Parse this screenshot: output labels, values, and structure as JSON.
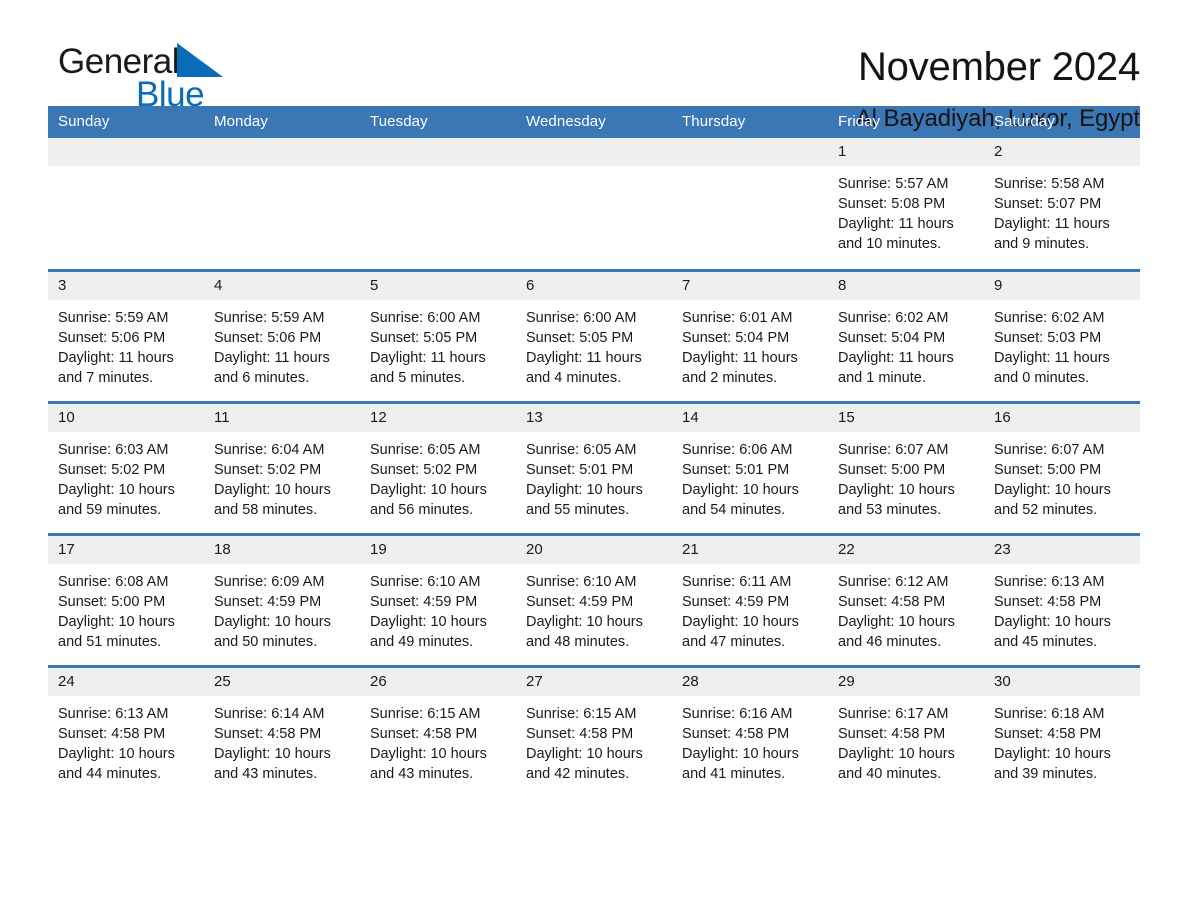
{
  "brand": {
    "name_part1": "General",
    "name_part2": "Blue",
    "logo_icon": "blue-triangle-mark",
    "accent_color": "#0a6cb8"
  },
  "header": {
    "title": "November 2024",
    "subtitle": "Al Bayadiyah, Luxor, Egypt"
  },
  "theme": {
    "header_bg": "#3b77b4",
    "daynum_bg": "#efefef",
    "row_border": "#3b77b4"
  },
  "weekday_headers": [
    "Sunday",
    "Monday",
    "Tuesday",
    "Wednesday",
    "Thursday",
    "Friday",
    "Saturday"
  ],
  "weeks": [
    [
      {
        "day": "",
        "empty": true,
        "sunrise": "",
        "sunset": "",
        "daylight1": "",
        "daylight2": ""
      },
      {
        "day": "",
        "empty": true,
        "sunrise": "",
        "sunset": "",
        "daylight1": "",
        "daylight2": ""
      },
      {
        "day": "",
        "empty": true,
        "sunrise": "",
        "sunset": "",
        "daylight1": "",
        "daylight2": ""
      },
      {
        "day": "",
        "empty": true,
        "sunrise": "",
        "sunset": "",
        "daylight1": "",
        "daylight2": ""
      },
      {
        "day": "",
        "empty": true,
        "sunrise": "",
        "sunset": "",
        "daylight1": "",
        "daylight2": ""
      },
      {
        "day": "1",
        "empty": false,
        "sunrise": "Sunrise: 5:57 AM",
        "sunset": "Sunset: 5:08 PM",
        "daylight1": "Daylight: 11 hours",
        "daylight2": "and 10 minutes."
      },
      {
        "day": "2",
        "empty": false,
        "sunrise": "Sunrise: 5:58 AM",
        "sunset": "Sunset: 5:07 PM",
        "daylight1": "Daylight: 11 hours",
        "daylight2": "and 9 minutes."
      }
    ],
    [
      {
        "day": "3",
        "empty": false,
        "sunrise": "Sunrise: 5:59 AM",
        "sunset": "Sunset: 5:06 PM",
        "daylight1": "Daylight: 11 hours",
        "daylight2": "and 7 minutes."
      },
      {
        "day": "4",
        "empty": false,
        "sunrise": "Sunrise: 5:59 AM",
        "sunset": "Sunset: 5:06 PM",
        "daylight1": "Daylight: 11 hours",
        "daylight2": "and 6 minutes."
      },
      {
        "day": "5",
        "empty": false,
        "sunrise": "Sunrise: 6:00 AM",
        "sunset": "Sunset: 5:05 PM",
        "daylight1": "Daylight: 11 hours",
        "daylight2": "and 5 minutes."
      },
      {
        "day": "6",
        "empty": false,
        "sunrise": "Sunrise: 6:00 AM",
        "sunset": "Sunset: 5:05 PM",
        "daylight1": "Daylight: 11 hours",
        "daylight2": "and 4 minutes."
      },
      {
        "day": "7",
        "empty": false,
        "sunrise": "Sunrise: 6:01 AM",
        "sunset": "Sunset: 5:04 PM",
        "daylight1": "Daylight: 11 hours",
        "daylight2": "and 2 minutes."
      },
      {
        "day": "8",
        "empty": false,
        "sunrise": "Sunrise: 6:02 AM",
        "sunset": "Sunset: 5:04 PM",
        "daylight1": "Daylight: 11 hours",
        "daylight2": "and 1 minute."
      },
      {
        "day": "9",
        "empty": false,
        "sunrise": "Sunrise: 6:02 AM",
        "sunset": "Sunset: 5:03 PM",
        "daylight1": "Daylight: 11 hours",
        "daylight2": "and 0 minutes."
      }
    ],
    [
      {
        "day": "10",
        "empty": false,
        "sunrise": "Sunrise: 6:03 AM",
        "sunset": "Sunset: 5:02 PM",
        "daylight1": "Daylight: 10 hours",
        "daylight2": "and 59 minutes."
      },
      {
        "day": "11",
        "empty": false,
        "sunrise": "Sunrise: 6:04 AM",
        "sunset": "Sunset: 5:02 PM",
        "daylight1": "Daylight: 10 hours",
        "daylight2": "and 58 minutes."
      },
      {
        "day": "12",
        "empty": false,
        "sunrise": "Sunrise: 6:05 AM",
        "sunset": "Sunset: 5:02 PM",
        "daylight1": "Daylight: 10 hours",
        "daylight2": "and 56 minutes."
      },
      {
        "day": "13",
        "empty": false,
        "sunrise": "Sunrise: 6:05 AM",
        "sunset": "Sunset: 5:01 PM",
        "daylight1": "Daylight: 10 hours",
        "daylight2": "and 55 minutes."
      },
      {
        "day": "14",
        "empty": false,
        "sunrise": "Sunrise: 6:06 AM",
        "sunset": "Sunset: 5:01 PM",
        "daylight1": "Daylight: 10 hours",
        "daylight2": "and 54 minutes."
      },
      {
        "day": "15",
        "empty": false,
        "sunrise": "Sunrise: 6:07 AM",
        "sunset": "Sunset: 5:00 PM",
        "daylight1": "Daylight: 10 hours",
        "daylight2": "and 53 minutes."
      },
      {
        "day": "16",
        "empty": false,
        "sunrise": "Sunrise: 6:07 AM",
        "sunset": "Sunset: 5:00 PM",
        "daylight1": "Daylight: 10 hours",
        "daylight2": "and 52 minutes."
      }
    ],
    [
      {
        "day": "17",
        "empty": false,
        "sunrise": "Sunrise: 6:08 AM",
        "sunset": "Sunset: 5:00 PM",
        "daylight1": "Daylight: 10 hours",
        "daylight2": "and 51 minutes."
      },
      {
        "day": "18",
        "empty": false,
        "sunrise": "Sunrise: 6:09 AM",
        "sunset": "Sunset: 4:59 PM",
        "daylight1": "Daylight: 10 hours",
        "daylight2": "and 50 minutes."
      },
      {
        "day": "19",
        "empty": false,
        "sunrise": "Sunrise: 6:10 AM",
        "sunset": "Sunset: 4:59 PM",
        "daylight1": "Daylight: 10 hours",
        "daylight2": "and 49 minutes."
      },
      {
        "day": "20",
        "empty": false,
        "sunrise": "Sunrise: 6:10 AM",
        "sunset": "Sunset: 4:59 PM",
        "daylight1": "Daylight: 10 hours",
        "daylight2": "and 48 minutes."
      },
      {
        "day": "21",
        "empty": false,
        "sunrise": "Sunrise: 6:11 AM",
        "sunset": "Sunset: 4:59 PM",
        "daylight1": "Daylight: 10 hours",
        "daylight2": "and 47 minutes."
      },
      {
        "day": "22",
        "empty": false,
        "sunrise": "Sunrise: 6:12 AM",
        "sunset": "Sunset: 4:58 PM",
        "daylight1": "Daylight: 10 hours",
        "daylight2": "and 46 minutes."
      },
      {
        "day": "23",
        "empty": false,
        "sunrise": "Sunrise: 6:13 AM",
        "sunset": "Sunset: 4:58 PM",
        "daylight1": "Daylight: 10 hours",
        "daylight2": "and 45 minutes."
      }
    ],
    [
      {
        "day": "24",
        "empty": false,
        "sunrise": "Sunrise: 6:13 AM",
        "sunset": "Sunset: 4:58 PM",
        "daylight1": "Daylight: 10 hours",
        "daylight2": "and 44 minutes."
      },
      {
        "day": "25",
        "empty": false,
        "sunrise": "Sunrise: 6:14 AM",
        "sunset": "Sunset: 4:58 PM",
        "daylight1": "Daylight: 10 hours",
        "daylight2": "and 43 minutes."
      },
      {
        "day": "26",
        "empty": false,
        "sunrise": "Sunrise: 6:15 AM",
        "sunset": "Sunset: 4:58 PM",
        "daylight1": "Daylight: 10 hours",
        "daylight2": "and 43 minutes."
      },
      {
        "day": "27",
        "empty": false,
        "sunrise": "Sunrise: 6:15 AM",
        "sunset": "Sunset: 4:58 PM",
        "daylight1": "Daylight: 10 hours",
        "daylight2": "and 42 minutes."
      },
      {
        "day": "28",
        "empty": false,
        "sunrise": "Sunrise: 6:16 AM",
        "sunset": "Sunset: 4:58 PM",
        "daylight1": "Daylight: 10 hours",
        "daylight2": "and 41 minutes."
      },
      {
        "day": "29",
        "empty": false,
        "sunrise": "Sunrise: 6:17 AM",
        "sunset": "Sunset: 4:58 PM",
        "daylight1": "Daylight: 10 hours",
        "daylight2": "and 40 minutes."
      },
      {
        "day": "30",
        "empty": false,
        "sunrise": "Sunrise: 6:18 AM",
        "sunset": "Sunset: 4:58 PM",
        "daylight1": "Daylight: 10 hours",
        "daylight2": "and 39 minutes."
      }
    ]
  ]
}
